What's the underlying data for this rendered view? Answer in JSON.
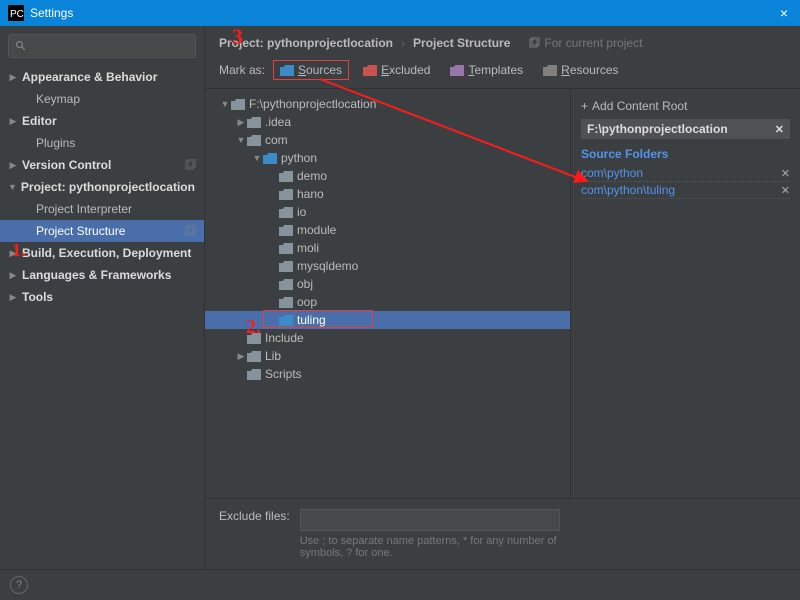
{
  "titlebar": {
    "title": "Settings",
    "close": "×"
  },
  "sidebar": {
    "search_placeholder": "",
    "items": [
      {
        "label": "Appearance & Behavior",
        "chev": "right",
        "bold": true
      },
      {
        "label": "Keymap",
        "indent": 1
      },
      {
        "label": "Editor",
        "chev": "right",
        "bold": true
      },
      {
        "label": "Plugins",
        "indent": 1
      },
      {
        "label": "Version Control",
        "chev": "right",
        "bold": true,
        "copy": true
      },
      {
        "label": "Project: pythonprojectlocation",
        "chev": "down",
        "bold": true,
        "copy": true
      },
      {
        "label": "Project Interpreter",
        "indent": 1
      },
      {
        "label": "Project Structure",
        "indent": 1,
        "selected": true,
        "copy": true
      },
      {
        "label": "Build, Execution, Deployment",
        "chev": "right",
        "bold": true
      },
      {
        "label": "Languages & Frameworks",
        "chev": "right",
        "bold": true
      },
      {
        "label": "Tools",
        "chev": "right",
        "bold": true
      }
    ]
  },
  "breadcrumb": {
    "a": "Project: pythonprojectlocation",
    "sep": "›",
    "b": "Project Structure",
    "for": "For current project"
  },
  "markbar": {
    "label": "Mark as:",
    "sources": "Sources",
    "excluded": "Excluded",
    "templates": "Templates",
    "resources": "Resources"
  },
  "folders": {
    "root": "F:\\pythonprojectlocation",
    "idea": ".idea",
    "com": "com",
    "python": "python",
    "children": [
      "demo",
      "hano",
      "io",
      "module",
      "moli",
      "mysqldemo",
      "obj",
      "oop"
    ],
    "tuling": "tuling",
    "include": "Include",
    "lib": "Lib",
    "scripts": "Scripts"
  },
  "sidepanel": {
    "add": "Add Content Root",
    "root": "F:\\pythonprojectlocation",
    "section": "Source Folders",
    "src": [
      "com\\python",
      "com\\python\\tuling"
    ]
  },
  "exclude": {
    "label": "Exclude files:",
    "value": "",
    "hint1": "Use ; to separate name patterns, * for any number of",
    "hint2": "symbols, ? for one."
  },
  "help": "?",
  "colors": {
    "sources": "#3d8ac9",
    "excluded": "#c75450",
    "templates": "#9876aa",
    "resources": "#808080"
  },
  "annotations": {
    "n1": "1.",
    "n2": "2.",
    "n3": "3"
  }
}
